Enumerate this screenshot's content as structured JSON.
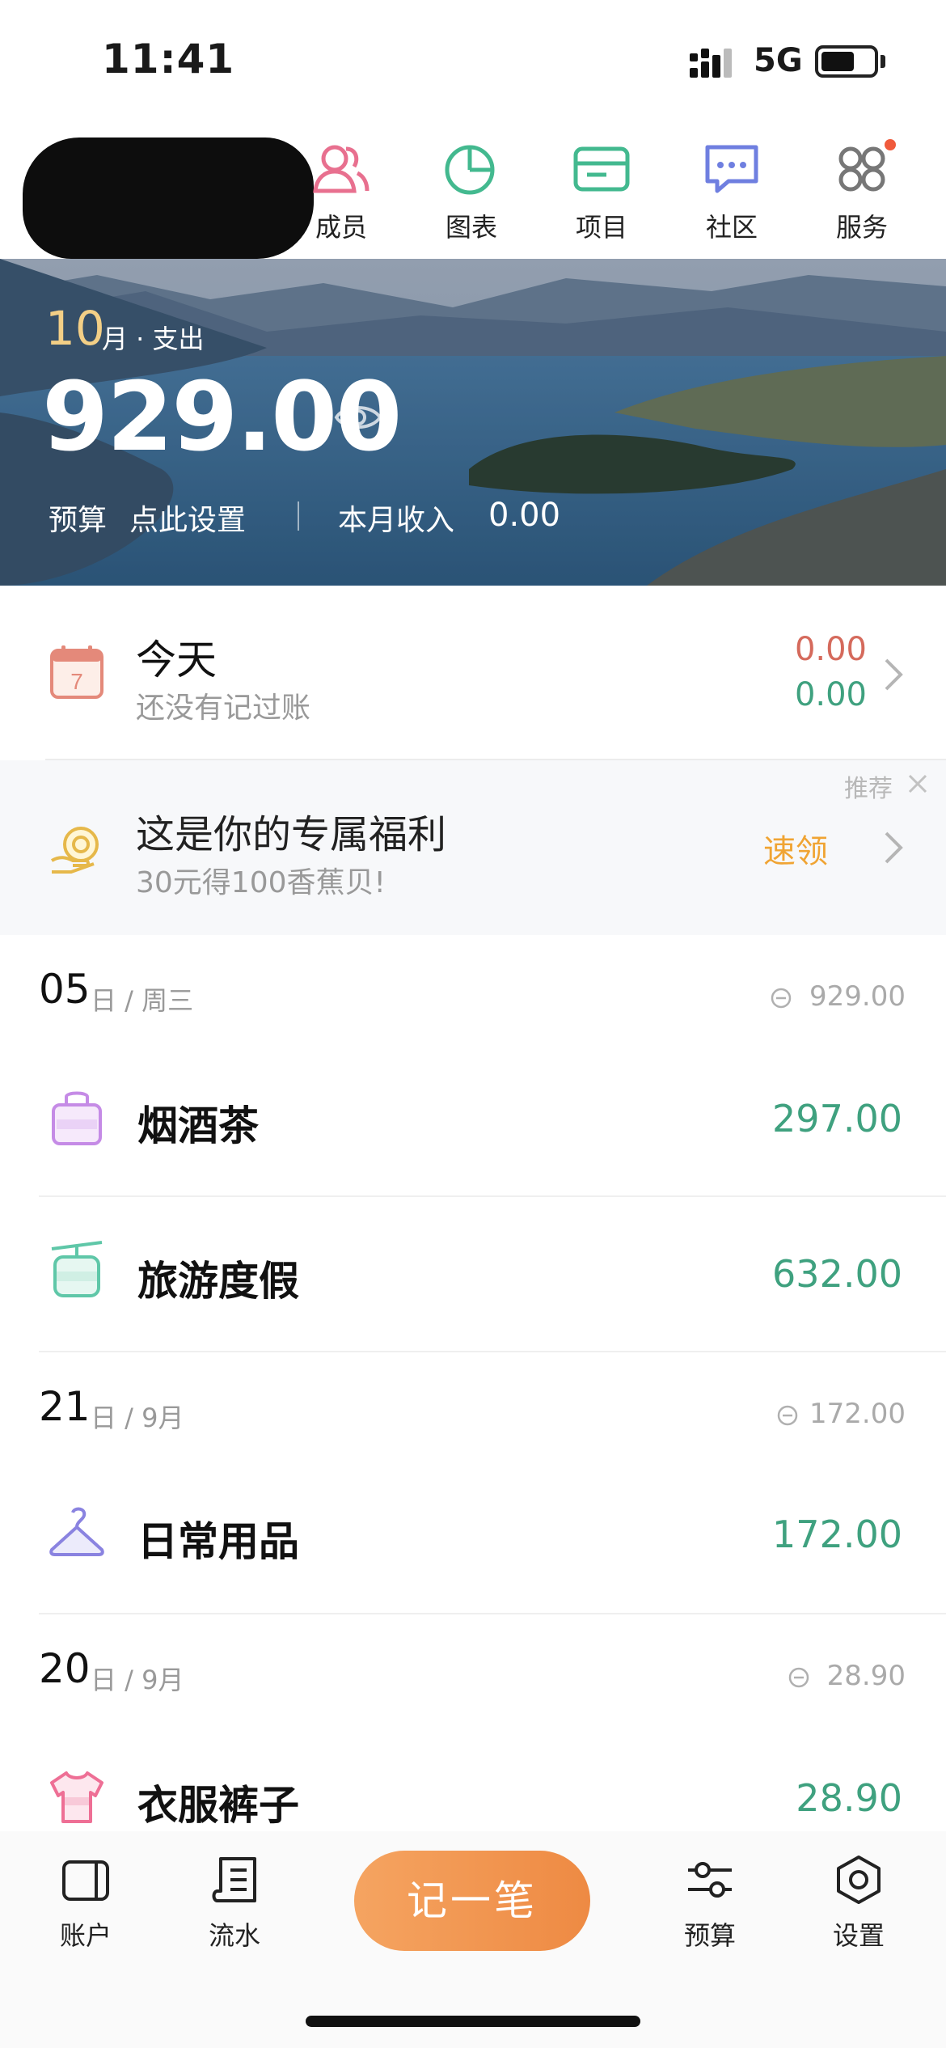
{
  "status_bar": {
    "time": "11:41",
    "network": "5G"
  },
  "top_nav": {
    "items": [
      {
        "label": "成员",
        "icon": "members-icon",
        "color": "#e8708f"
      },
      {
        "label": "图表",
        "icon": "pie-chart-icon",
        "color": "#43b98f"
      },
      {
        "label": "项目",
        "icon": "folder-icon",
        "color": "#43b98f"
      },
      {
        "label": "社区",
        "icon": "chat-bubble-icon",
        "color": "#6f7fe0"
      },
      {
        "label": "服务",
        "icon": "grid-services-icon",
        "color": "#888888"
      }
    ]
  },
  "banner": {
    "month": "10",
    "month_label": "月 · 支出",
    "expense": "929.00",
    "budget_label": "预算",
    "budget_action": "点此设置",
    "income_label": "本月收入",
    "income": "0.00"
  },
  "today": {
    "title": "今天",
    "subtitle": "还没有记过账",
    "expense": "0.00",
    "income": "0.00"
  },
  "promo": {
    "tag": "推荐",
    "title": "这是你的专属福利",
    "subtitle": "30元得100香蕉贝!",
    "action": "速领"
  },
  "days": [
    {
      "day": "05",
      "meta": "日 / 周三",
      "total": "929.00",
      "entries": [
        {
          "name": "烟酒茶",
          "amount": "297.00",
          "icon": "bag-icon",
          "color": "#c58be6"
        },
        {
          "name": "旅游度假",
          "amount": "632.00",
          "icon": "cable-car-icon",
          "color": "#5fc7a8"
        }
      ]
    },
    {
      "day": "21",
      "meta": "日 / 9月",
      "total": "172.00",
      "entries": [
        {
          "name": "日常用品",
          "amount": "172.00",
          "icon": "hanger-icon",
          "color": "#8a83e0"
        }
      ]
    },
    {
      "day": "20",
      "meta": "日 / 9月",
      "total": "28.90",
      "entries": [
        {
          "name": "衣服裤子",
          "amount": "28.90",
          "icon": "tshirt-icon",
          "color": "#ee6f95"
        }
      ]
    }
  ],
  "tab_bar": {
    "account": "账户",
    "flow": "流水",
    "record": "记一笔",
    "budget": "预算",
    "settings": "设置"
  },
  "colors": {
    "expense_red": "#d56a5c",
    "income_green": "#3fa17f",
    "accent_orange": "#ee8a43",
    "gold": "#f3cf86"
  }
}
